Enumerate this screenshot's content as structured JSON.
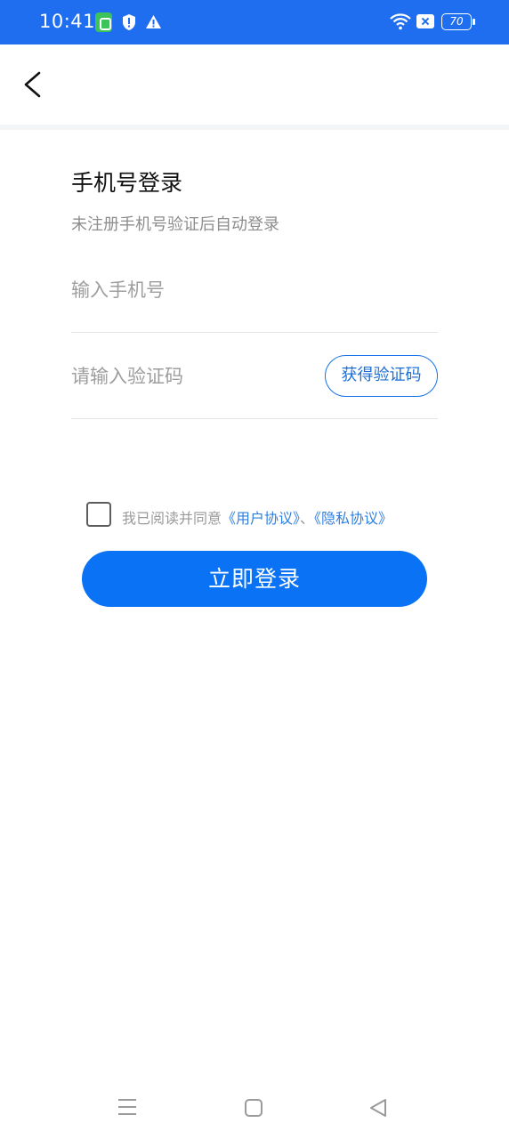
{
  "status_bar": {
    "time": "10:41",
    "battery": "70",
    "icons": [
      "app-notification-icon",
      "shield-icon",
      "warning-icon",
      "wifi-icon",
      "close-box-icon",
      "battery-icon"
    ],
    "background": "#1f6ef0"
  },
  "header": {
    "back_icon": "chevron-left-icon"
  },
  "login": {
    "title": "手机号登录",
    "subtitle": "未注册手机号验证后自动登录",
    "phone_placeholder": "输入手机号",
    "code_placeholder": "请输入验证码",
    "get_code_label": "获得验证码",
    "agree_prefix": "我已阅读并同意",
    "user_agreement": "《用户协议》",
    "separator": "、",
    "privacy_policy": "《隐私协议》",
    "agreed": false,
    "submit_label": "立即登录"
  },
  "nav_bar": {
    "icons": [
      "menu-icon",
      "home-icon",
      "back-icon"
    ]
  },
  "colors": {
    "accent": "#0a73f5",
    "link": "#2f7fe0"
  }
}
